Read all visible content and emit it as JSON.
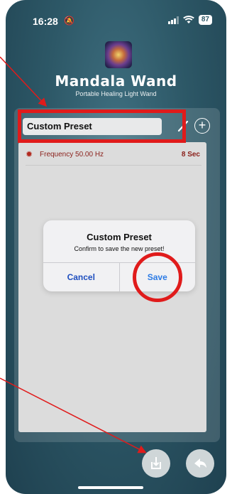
{
  "status": {
    "time": "16:28",
    "battery": "87"
  },
  "brand": {
    "title": "Mandala Wand",
    "subtitle": "Portable Healing Light Wand"
  },
  "preset": {
    "name": "Custom Preset"
  },
  "list": {
    "items": [
      {
        "icon": "sun-icon",
        "frequency": "Frequency 50.00 Hz",
        "duration": "8 Sec"
      }
    ]
  },
  "dialog": {
    "title": "Custom Preset",
    "message": "Confirm to save the new preset!",
    "cancel_label": "Cancel",
    "save_label": "Save"
  },
  "annotations": {
    "color": "#e01b1b"
  },
  "icons": {
    "edit": "pencil-icon",
    "add": "plus-circle-icon",
    "save_preset": "save-download-icon",
    "back": "back-arrow-icon"
  }
}
